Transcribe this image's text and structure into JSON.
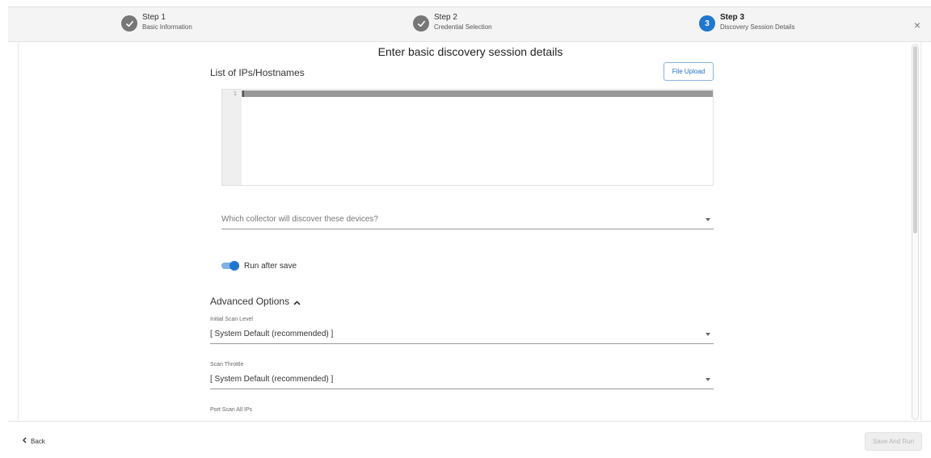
{
  "stepper": {
    "steps": [
      {
        "title": "Step 1",
        "subtitle": "Basic Information",
        "state": "completed",
        "icon": "check-icon"
      },
      {
        "title": "Step 2",
        "subtitle": "Credential Selection",
        "state": "completed",
        "icon": "check-icon"
      },
      {
        "title": "Step 3",
        "subtitle": "Discovery Session Details",
        "state": "active",
        "number": "3"
      }
    ],
    "close_icon": "close-icon",
    "close_glyph": "×"
  },
  "main": {
    "heading": "Enter basic discovery session details",
    "ips_label": "List of IPs/Hostnames",
    "file_upload_label": "File Upload",
    "editor": {
      "line_number": "1",
      "content": ""
    },
    "collector": {
      "placeholder": "Which collector will discover these devices?",
      "value": ""
    },
    "run_after_save": {
      "label": "Run after save",
      "enabled": true
    },
    "advanced": {
      "title": "Advanced Options",
      "expanded": true,
      "initial_scan_level": {
        "label": "Initial Scan Level",
        "value": "[ System Default (recommended) ]"
      },
      "scan_throttle": {
        "label": "Scan Throttle",
        "value": "[ System Default (recommended) ]"
      },
      "port_scan_all_ips": {
        "label": "Port Scan All IPs"
      }
    }
  },
  "footer": {
    "back_label": "Back",
    "save_and_run_label": "Save And Run",
    "save_and_run_enabled": false
  },
  "colors": {
    "accent": "#1f77d0",
    "completed_step": "#777777",
    "disabled_button_bg": "#eeeeee",
    "disabled_button_text": "#b5b5b5"
  }
}
